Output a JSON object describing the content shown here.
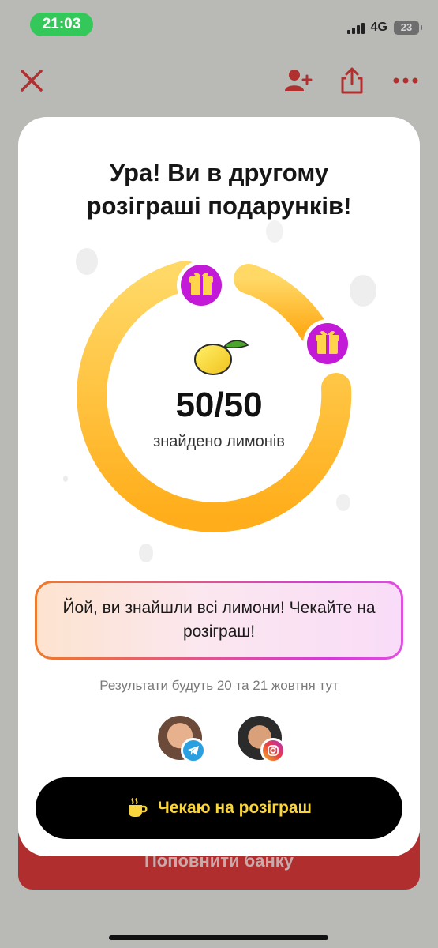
{
  "status_bar": {
    "time": "21:03",
    "network": "4G",
    "battery": "23"
  },
  "nav": {
    "close_icon": "close-icon",
    "add_user_icon": "add-user-icon",
    "share_icon": "share-icon",
    "more_icon": "more-icon"
  },
  "background": {
    "button_label": "Поповнити банку"
  },
  "modal": {
    "title_line1": "Ура! Ви в другому",
    "title_line2": "розіграші подарунків!",
    "progress": {
      "found": 50,
      "total": 50,
      "text": "50/50",
      "label": "знайдено лимонів"
    },
    "message": "Йой, ви знайшли всі лимони! Чекайте на розіграш!",
    "results_text": "Результати будуть 20 та 21 жовтня тут",
    "socials": [
      {
        "platform": "telegram",
        "icon": "telegram-icon"
      },
      {
        "platform": "instagram",
        "icon": "instagram-icon"
      }
    ],
    "cta_label": "Чекаю на розіграш",
    "cta_icon": "coffee-cup-icon"
  },
  "colors": {
    "accent_red": "#c23030",
    "ring_yellow": "#ffc23a",
    "gift_purple": "#c21ad6",
    "cta_text": "#f8d43f"
  }
}
